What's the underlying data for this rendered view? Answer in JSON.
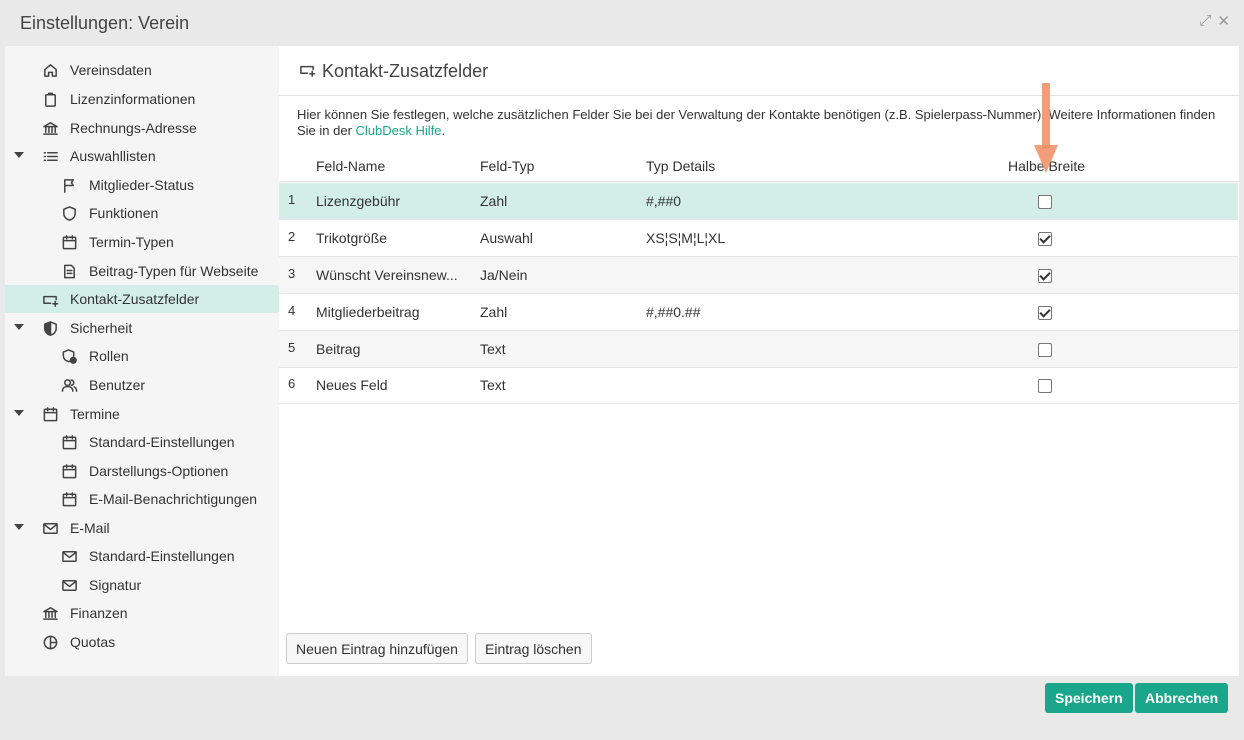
{
  "window": {
    "title": "Einstellungen: Verein"
  },
  "sidebar": {
    "items": [
      {
        "label": "Vereinsdaten",
        "icon": "home-icon"
      },
      {
        "label": "Lizenzinformationen",
        "icon": "clipboard-icon"
      },
      {
        "label": "Rechnungs-Adresse",
        "icon": "bank-icon"
      },
      {
        "label": "Auswahllisten",
        "icon": "list-icon"
      },
      {
        "label": "Mitglieder-Status",
        "icon": "flag-icon"
      },
      {
        "label": "Funktionen",
        "icon": "shield-icon"
      },
      {
        "label": "Termin-Typen",
        "icon": "calendar-icon"
      },
      {
        "label": "Beitrag-Typen für Webseite",
        "icon": "document-icon"
      },
      {
        "label": "Kontakt-Zusatzfelder",
        "icon": "field-add-icon"
      },
      {
        "label": "Sicherheit",
        "icon": "shield-half-icon"
      },
      {
        "label": "Rollen",
        "icon": "shield-lock-icon"
      },
      {
        "label": "Benutzer",
        "icon": "users-icon"
      },
      {
        "label": "Termine",
        "icon": "calendar-icon"
      },
      {
        "label": "Standard-Einstellungen",
        "icon": "calendar-icon"
      },
      {
        "label": "Darstellungs-Optionen",
        "icon": "calendar-icon"
      },
      {
        "label": "E-Mail-Benachrichtigungen",
        "icon": "calendar-icon"
      },
      {
        "label": "E-Mail",
        "icon": "mail-icon"
      },
      {
        "label": "Standard-Einstellungen",
        "icon": "mail-icon"
      },
      {
        "label": "Signatur",
        "icon": "mail-icon"
      },
      {
        "label": "Finanzen",
        "icon": "bank-icon"
      },
      {
        "label": "Quotas",
        "icon": "pie-icon"
      }
    ]
  },
  "main": {
    "title": "Kontakt-Zusatzfelder",
    "description": "Hier können Sie festlegen, welche zusätzlichen Felder Sie bei der Verwaltung der Kontakte benötigen (z.B. Spielerpass-Nummer). Weitere Informationen finden Sie in der ",
    "help_link": "ClubDesk Hilfe",
    "description_end": ".",
    "columns": {
      "name": "Feld-Name",
      "type": "Feld-Typ",
      "details": "Typ Details",
      "half_width": "Halbe Breite"
    },
    "rows": [
      {
        "num": "1",
        "name": "Lizenzgebühr",
        "type": "Zahl",
        "details": "#,##0",
        "half_width": false
      },
      {
        "num": "2",
        "name": "Trikotgröße",
        "type": "Auswahl",
        "details": "XS¦S¦M¦L¦XL",
        "half_width": true
      },
      {
        "num": "3",
        "name": "Wünscht Vereinsnew...",
        "type": "Ja/Nein",
        "details": "",
        "half_width": true
      },
      {
        "num": "4",
        "name": "Mitgliederbeitrag",
        "type": "Zahl",
        "details": "#,##0.##",
        "half_width": true
      },
      {
        "num": "5",
        "name": "Beitrag",
        "type": "Text",
        "details": "",
        "half_width": false
      },
      {
        "num": "6",
        "name": "Neues Feld",
        "type": "Text",
        "details": "",
        "half_width": false
      }
    ],
    "add_button": "Neuen Eintrag hinzufügen",
    "delete_button": "Eintrag löschen"
  },
  "footer": {
    "save_button": "Speichern",
    "cancel_button": "Abbrechen"
  },
  "colors": {
    "accent": "#1aa68a",
    "selection": "#d3eee8",
    "annotation_arrow": "#f0936a"
  }
}
